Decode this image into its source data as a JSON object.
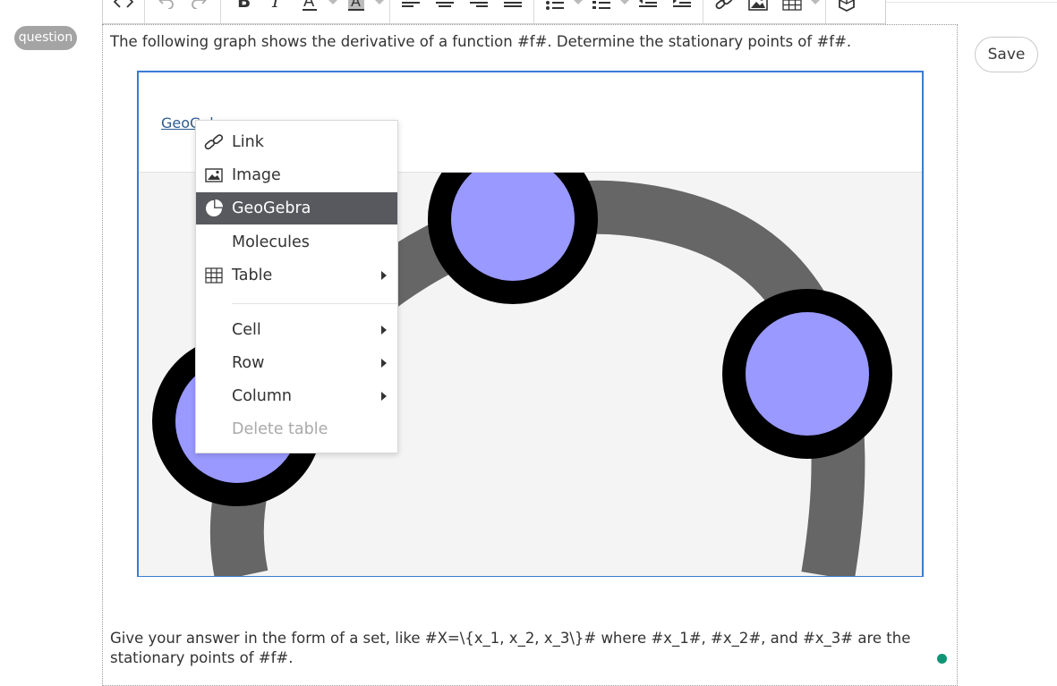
{
  "badge": {
    "label": "question"
  },
  "save": {
    "label": "Save"
  },
  "question": {
    "text": "The following graph shows the derivative of a function #f#. Determine the stationary points of #f#."
  },
  "geogebra": {
    "link_text": "GeoGebra"
  },
  "answer": {
    "text": "Give your answer in the form of a set, like #X=\\{x_1, x_2, x_3\\}# where #x_1#, #x_2#, and #x_3# are the stationary points of #f#."
  },
  "toolbar": {
    "buttons": [
      "source-code-icon",
      "undo-icon",
      "redo-icon",
      "bold-icon",
      "italic-icon",
      "font-color-icon",
      "background-color-icon",
      "align-left-icon",
      "align-center-icon",
      "align-right-icon",
      "align-justify-icon",
      "bullet-list-icon",
      "numbered-list-icon",
      "outdent-icon",
      "indent-icon",
      "link-icon",
      "image-icon",
      "table-icon",
      "geogebra-icon"
    ]
  },
  "context_menu": {
    "items": [
      {
        "label": "Link",
        "icon": "link-icon",
        "submenu": false,
        "selected": false,
        "disabled": false
      },
      {
        "label": "Image",
        "icon": "image-icon",
        "submenu": false,
        "selected": false,
        "disabled": false
      },
      {
        "label": "GeoGebra",
        "icon": "geogebra-icon",
        "submenu": false,
        "selected": true,
        "disabled": false
      },
      {
        "label": "Molecules",
        "icon": "",
        "submenu": false,
        "selected": false,
        "disabled": false
      },
      {
        "label": "Table",
        "icon": "table-icon",
        "submenu": true,
        "selected": false,
        "disabled": false
      },
      {
        "label": "Cell",
        "icon": "",
        "submenu": true,
        "selected": false,
        "disabled": false
      },
      {
        "label": "Row",
        "icon": "",
        "submenu": true,
        "selected": false,
        "disabled": false
      },
      {
        "label": "Column",
        "icon": "",
        "submenu": true,
        "selected": false,
        "disabled": false
      },
      {
        "label": "Delete table",
        "icon": "",
        "submenu": false,
        "selected": false,
        "disabled": true
      }
    ]
  },
  "colors": {
    "accent_border": "#3a7bd5",
    "menu_selected": "#58595f",
    "status_dot": "#0f9575",
    "point_fill": "#9999ff",
    "curve": "#666666"
  }
}
